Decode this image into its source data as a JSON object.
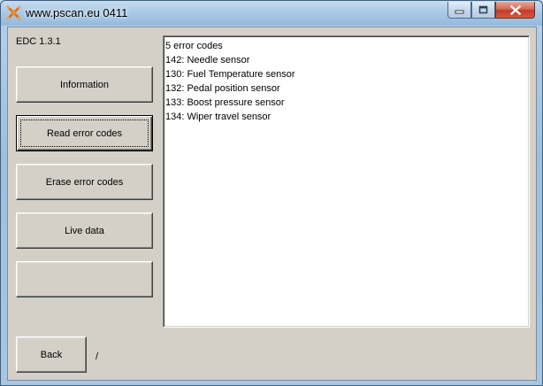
{
  "window": {
    "title": "www.pscan.eu 0411",
    "icon": "pscan-logo-icon"
  },
  "client": {
    "version": "EDC 1.3.1",
    "buttons": [
      {
        "label": "Information"
      },
      {
        "label": "Read error codes"
      },
      {
        "label": "Erase error codes"
      },
      {
        "label": "Live data"
      },
      {
        "label": ""
      }
    ],
    "back_label": "Back",
    "status_text": "/",
    "output_lines": [
      "5 error codes",
      "142: Needle sensor",
      "130: Fuel Temperature sensor",
      "132: Pedal position sensor",
      "133: Boost pressure sensor",
      "134: Wiper travel sensor"
    ]
  },
  "colors": {
    "close_button": "#c0392b",
    "client_background": "#d4d0c8"
  }
}
